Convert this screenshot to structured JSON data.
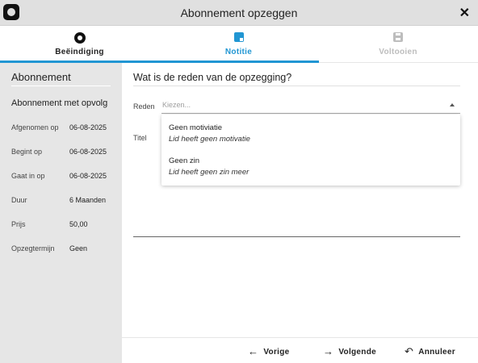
{
  "window": {
    "title": "Abonnement opzeggen",
    "close_glyph": "✕"
  },
  "steps": [
    {
      "label": "Beëindiging",
      "icon": "circle-icon",
      "state": "done"
    },
    {
      "label": "Notitie",
      "icon": "note-icon",
      "state": "active",
      "color": "#2196d3"
    },
    {
      "label": "Voltooien",
      "icon": "save-icon",
      "state": "disabled",
      "color": "#bdbdbd"
    }
  ],
  "sidebar": {
    "heading": "Abonnement",
    "subscription": "Abonnement met opvolg",
    "rows": [
      {
        "label": "Afgenomen op",
        "value": "06-08-2025"
      },
      {
        "label": "Begint op",
        "value": "06-08-2025"
      },
      {
        "label": "Gaat in op",
        "value": "06-08-2025"
      },
      {
        "label": "Duur",
        "value": "6 Maanden"
      },
      {
        "label": "Prijs",
        "value": "50,00"
      },
      {
        "label": "Opzegtermijn",
        "value": "Geen"
      }
    ]
  },
  "form": {
    "question": "Wat is de reden van de opzegging?",
    "reason_label": "Reden",
    "reason_placeholder": "Kiezen...",
    "title_label": "Titel",
    "options": [
      {
        "title": "Geen motiviatie",
        "subtitle": "Lid heeft geen motivatie"
      },
      {
        "title": "Geen zin",
        "subtitle": "Lid heeft geen zin meer"
      }
    ]
  },
  "footer": {
    "prev_label": "Vorige",
    "next_label": "Volgende",
    "cancel_label": "Annuleer"
  }
}
